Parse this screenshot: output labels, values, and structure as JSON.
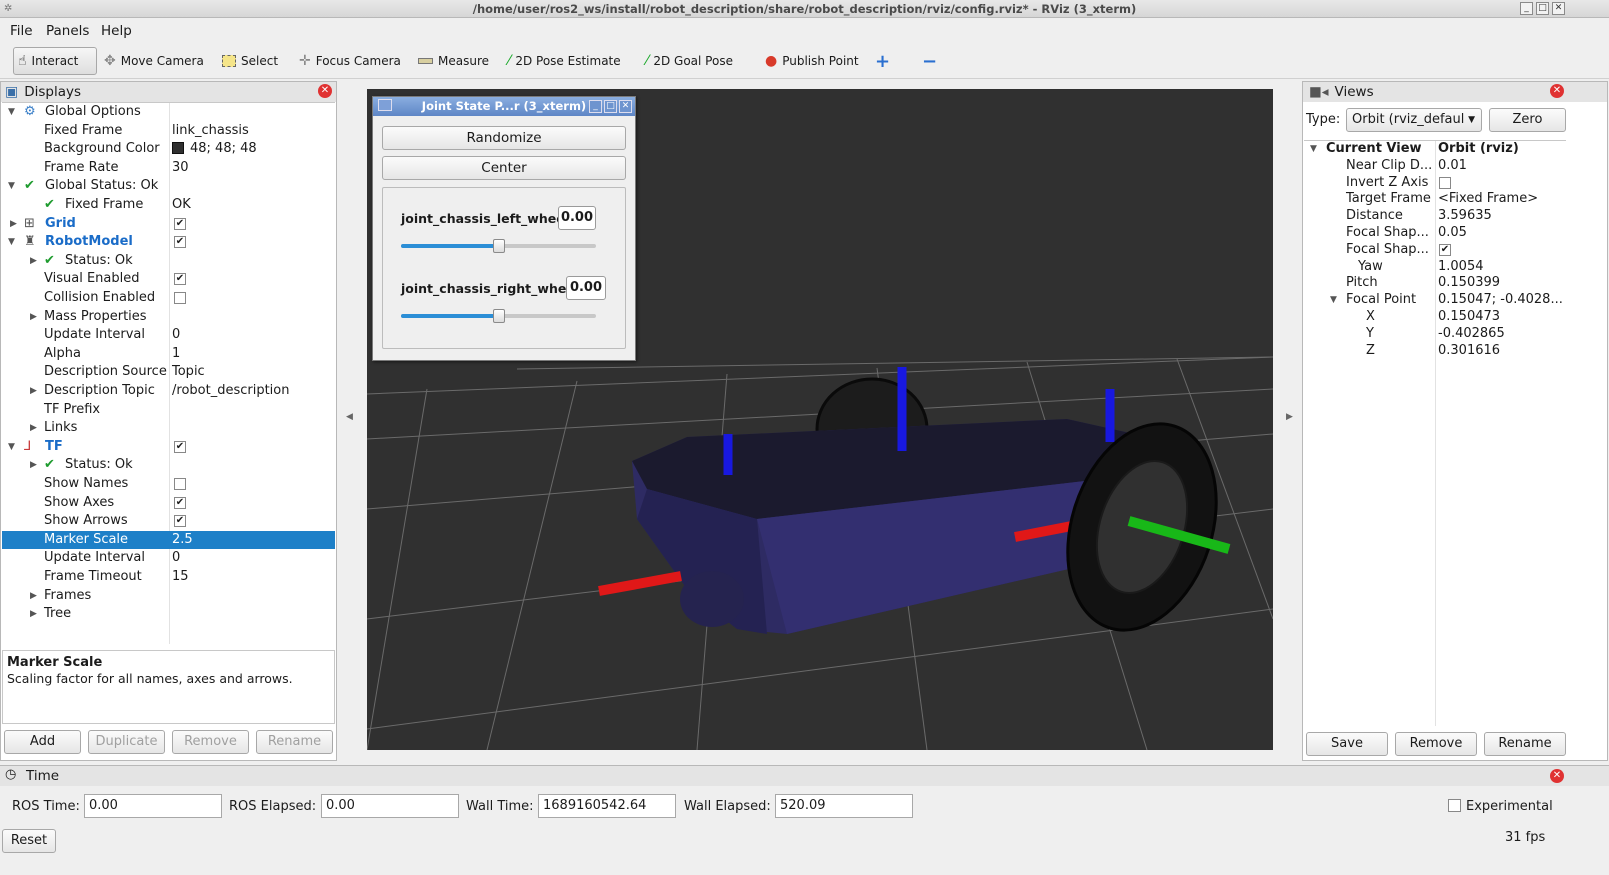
{
  "window": {
    "title": "/home/user/ros2_ws/install/robot_description/share/robot_description/rviz/config.rviz* - RViz (3_xterm)"
  },
  "menu": {
    "file": "File",
    "panels": "Panels",
    "help": "Help"
  },
  "toolbar": {
    "interact": "Interact",
    "move_camera": "Move Camera",
    "select": "Select",
    "focus_camera": "Focus Camera",
    "measure": "Measure",
    "pose_estimate": "2D Pose Estimate",
    "goal_pose": "2D Goal Pose",
    "publish_point": "Publish Point"
  },
  "displays": {
    "title": "Displays",
    "rows": {
      "global_options": "Global Options",
      "fixed_frame": "Fixed Frame",
      "fixed_frame_val": "link_chassis",
      "bg_color": "Background Color",
      "bg_color_val": "48; 48; 48",
      "frame_rate": "Frame Rate",
      "frame_rate_val": "30",
      "global_status": "Global Status: Ok",
      "gs_fixed_frame": "Fixed Frame",
      "gs_fixed_frame_val": "OK",
      "grid": "Grid",
      "robot_model": "RobotModel",
      "rm_status": "Status: Ok",
      "visual_enabled": "Visual Enabled",
      "collision_enabled": "Collision Enabled",
      "mass_properties": "Mass Properties",
      "update_interval": "Update Interval",
      "update_interval_val": "0",
      "alpha": "Alpha",
      "alpha_val": "1",
      "desc_source": "Description Source",
      "desc_source_val": "Topic",
      "desc_topic": "Description Topic",
      "desc_topic_val": "/robot_description",
      "tf_prefix": "TF Prefix",
      "links": "Links",
      "tf": "TF",
      "tf_status": "Status: Ok",
      "show_names": "Show Names",
      "show_axes": "Show Axes",
      "show_arrows": "Show Arrows",
      "marker_scale": "Marker Scale",
      "marker_scale_val": "2.5",
      "tf_update_interval": "Update Interval",
      "tf_update_interval_val": "0",
      "frame_timeout": "Frame Timeout",
      "frame_timeout_val": "15",
      "frames": "Frames",
      "tree": "Tree"
    },
    "description": {
      "heading": "Marker Scale",
      "text": "Scaling factor for all names, axes and arrows."
    },
    "buttons": {
      "add": "Add",
      "duplicate": "Duplicate",
      "remove": "Remove",
      "rename": "Rename"
    }
  },
  "joint_state_publisher": {
    "title": "Joint State P...r (3_xterm)",
    "randomize": "Randomize",
    "center": "Center",
    "joints": [
      {
        "name": "joint_chassis_left_wheel",
        "value": "0.00",
        "slider_fraction": 0.5
      },
      {
        "name": "joint_chassis_right_wheel",
        "value": "0.00",
        "slider_fraction": 0.5
      }
    ]
  },
  "views": {
    "title": "Views",
    "type_label": "Type:",
    "type_value": "Orbit (rviz_defaul",
    "zero": "Zero",
    "rows": {
      "current_view": "Current View",
      "current_view_val": "Orbit (rviz)",
      "near_clip": "Near Clip D...",
      "near_clip_val": "0.01",
      "invert_z": "Invert Z Axis",
      "target_frame": "Target Frame",
      "target_frame_val": "<Fixed Frame>",
      "distance": "Distance",
      "distance_val": "3.59635",
      "focal_shape1": "Focal Shap...",
      "focal_shape1_val": "0.05",
      "focal_shape2": "Focal Shap...",
      "yaw": "Yaw",
      "yaw_val": "1.0054",
      "pitch": "Pitch",
      "pitch_val": "0.150399",
      "focal_point": "Focal Point",
      "focal_point_val": "0.15047; -0.4028...",
      "x": "X",
      "x_val": "0.150473",
      "y": "Y",
      "y_val": "-0.402865",
      "z": "Z",
      "z_val": "0.301616"
    },
    "buttons": {
      "save": "Save",
      "remove": "Remove",
      "rename": "Rename"
    }
  },
  "time": {
    "title": "Time",
    "ros_time_label": "ROS Time:",
    "ros_time": "0.00",
    "ros_elapsed_label": "ROS Elapsed:",
    "ros_elapsed": "0.00",
    "wall_time_label": "Wall Time:",
    "wall_time": "1689160542.64",
    "wall_elapsed_label": "Wall Elapsed:",
    "wall_elapsed": "520.09",
    "experimental": "Experimental",
    "reset": "Reset",
    "fps": "31 fps"
  },
  "colors": {
    "selection": "#1e80c8",
    "viewport_bg": "#303030",
    "chassis": "#2d2a5e",
    "axis_x": "#e01818",
    "axis_y": "#18b818",
    "axis_z": "#1818e0"
  }
}
